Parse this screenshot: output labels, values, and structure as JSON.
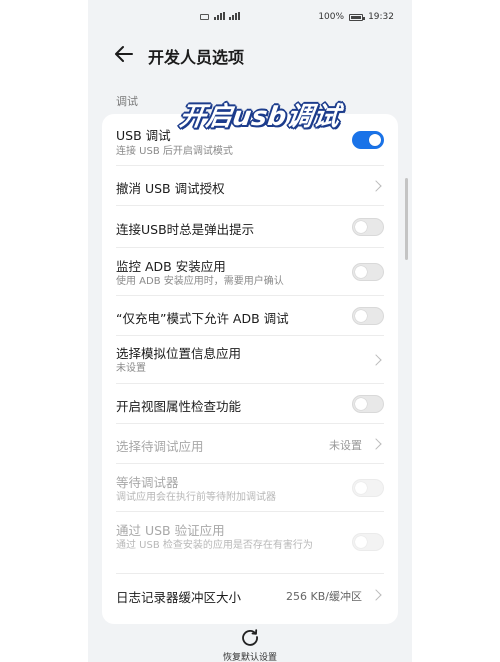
{
  "status_bar": {
    "battery": "100%",
    "time": "19:32"
  },
  "header": {
    "title": "开发人员选项"
  },
  "section": {
    "label": "调试"
  },
  "overlay": {
    "text": "开启usb调试"
  },
  "settings": [
    {
      "title": "USB 调试",
      "subtitle": "连接 USB 后开启调试模式",
      "control": "toggle",
      "on": true,
      "disabled": false
    },
    {
      "title": "撤消 USB 调试授权",
      "control": "chevron",
      "disabled": false
    },
    {
      "title": "连接USB时总是弹出提示",
      "control": "toggle",
      "on": false,
      "disabled": false
    },
    {
      "title": "监控 ADB 安装应用",
      "subtitle": "使用 ADB 安装应用时，需要用户确认",
      "control": "toggle",
      "on": false,
      "disabled": false
    },
    {
      "title": "“仅充电”模式下允许 ADB 调试",
      "control": "toggle",
      "on": false,
      "disabled": false
    },
    {
      "title": "选择模拟位置信息应用",
      "subtitle": "未设置",
      "control": "chevron",
      "disabled": false
    },
    {
      "title": "开启视图属性检查功能",
      "control": "toggle",
      "on": false,
      "disabled": false
    },
    {
      "title": "选择待调试应用",
      "value": "未设置",
      "control": "chevron",
      "disabled": true
    },
    {
      "title": "等待调试器",
      "subtitle": "调试应用会在执行前等待附加调试器",
      "control": "toggle",
      "on": false,
      "disabled": true
    },
    {
      "title": "通过 USB 验证应用",
      "subtitle": "通过 USB 检查安装的应用是否存在有害行为",
      "control": "toggle",
      "on": false,
      "disabled": true
    },
    {
      "title": "日志记录器缓冲区大小",
      "value": "256 KB/缓冲区",
      "control": "chevron",
      "disabled": false
    }
  ],
  "footer": {
    "reset_label": "恢复默认设置"
  },
  "colors": {
    "accent": "#1a73e8",
    "background": "#f1f3f5",
    "overlay_outline": "#1c3c8c"
  },
  "icons": {
    "back": "back-arrow-icon",
    "reset": "reset-icon"
  }
}
